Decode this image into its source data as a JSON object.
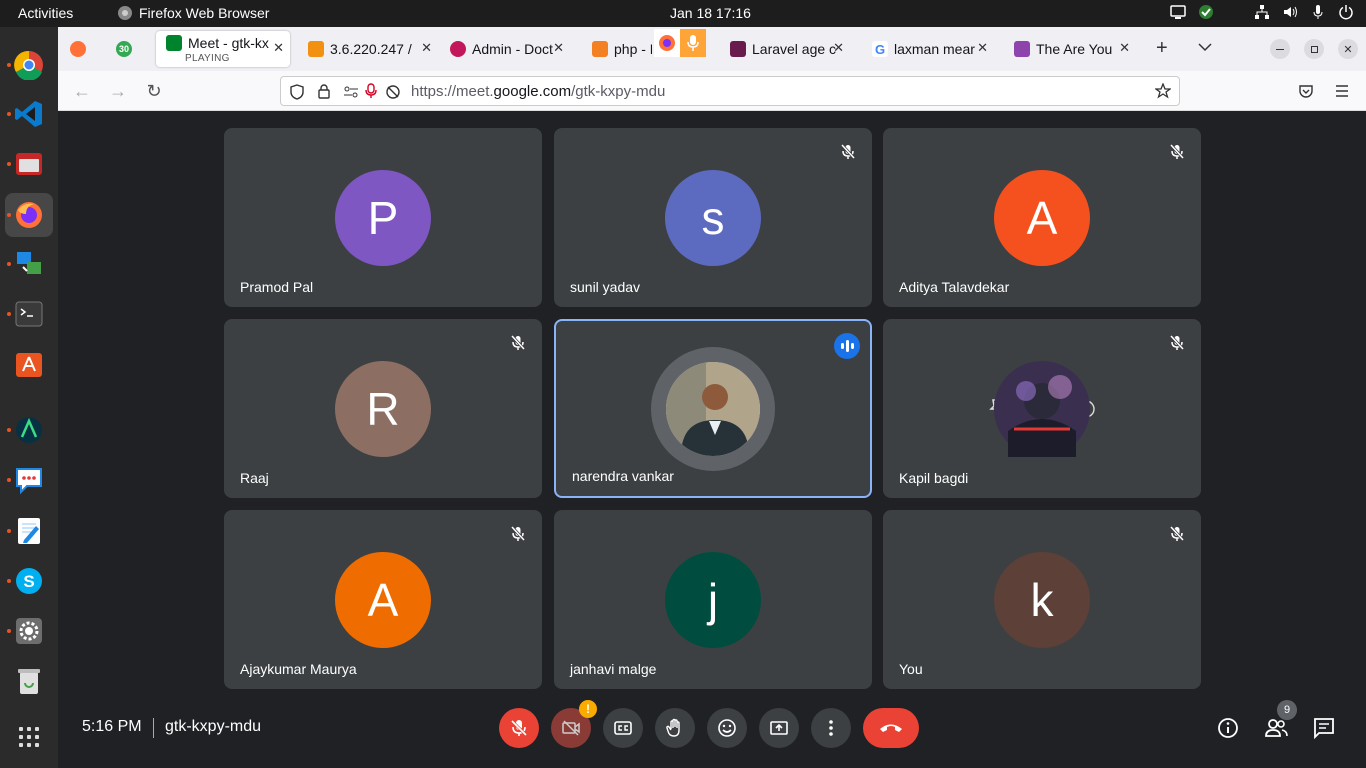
{
  "topbar": {
    "activities": "Activities",
    "app_name": "Firefox Web Browser",
    "clock": "Jan 18  17:16"
  },
  "dock": {
    "items": [
      "chrome-icon",
      "vscode-icon",
      "files-icon",
      "firefox-icon",
      "remote-desktop-icon",
      "terminal-icon",
      "software-center-icon",
      "android-studio-icon",
      "chat-icon",
      "text-editor-icon",
      "skype-icon",
      "settings-icon",
      "trash-icon",
      "show-apps-icon"
    ]
  },
  "tabs": [
    {
      "label": "",
      "favicon": "firefox-favicon"
    },
    {
      "label": "",
      "favicon": "calendar-favicon",
      "badge": "30"
    },
    {
      "label": "Meet - gtk-kx",
      "sub": "PLAYING",
      "favicon": "meet-favicon"
    },
    {
      "label": "3.6.220.247 /",
      "favicon": "phpmyadmin-favicon"
    },
    {
      "label": "Admin - Doct",
      "favicon": "admin-favicon"
    },
    {
      "label": "php - L",
      "favicon": "stackoverflow-favicon"
    },
    {
      "label": "Laravel age c",
      "favicon": "laravel-favicon"
    },
    {
      "label": "laxman mear",
      "favicon": "google-favicon"
    },
    {
      "label": "The Are You",
      "favicon": "are-you-favicon"
    }
  ],
  "nav": {
    "url_host": "https://meet.",
    "url_domain": "google.com",
    "url_path": "/gtk-kxpy-mdu"
  },
  "participants": [
    {
      "name": "Pramod Pal",
      "initial": "P",
      "color": "#7e57c2",
      "muted": false
    },
    {
      "name": "sunil yadav",
      "initial": "s",
      "color": "#5c6bc0",
      "muted": true
    },
    {
      "name": "Aditya Talavdekar",
      "initial": "A",
      "color": "#f4511e",
      "muted": true
    },
    {
      "name": "Raaj",
      "initial": "R",
      "color": "#8d6e63",
      "muted": true
    },
    {
      "name": "narendra vankar",
      "initial": "",
      "color": "#5f6368",
      "muted": false,
      "speaking": true
    },
    {
      "name": "Kapil bagdi",
      "initial": "",
      "color": "#4a3a5a",
      "muted": true
    },
    {
      "name": "Ajaykumar Maurya",
      "initial": "A",
      "color": "#ef6c00",
      "muted": true
    },
    {
      "name": "janhavi malge",
      "initial": "j",
      "color": "#004d40",
      "muted": false
    },
    {
      "name": "You",
      "initial": "k",
      "color": "#5d4037",
      "muted": true
    }
  ],
  "meeting": {
    "time": "5:16 PM",
    "code": "gtk-kxpy-mdu",
    "people_count": "9",
    "camera_alert": "!"
  }
}
